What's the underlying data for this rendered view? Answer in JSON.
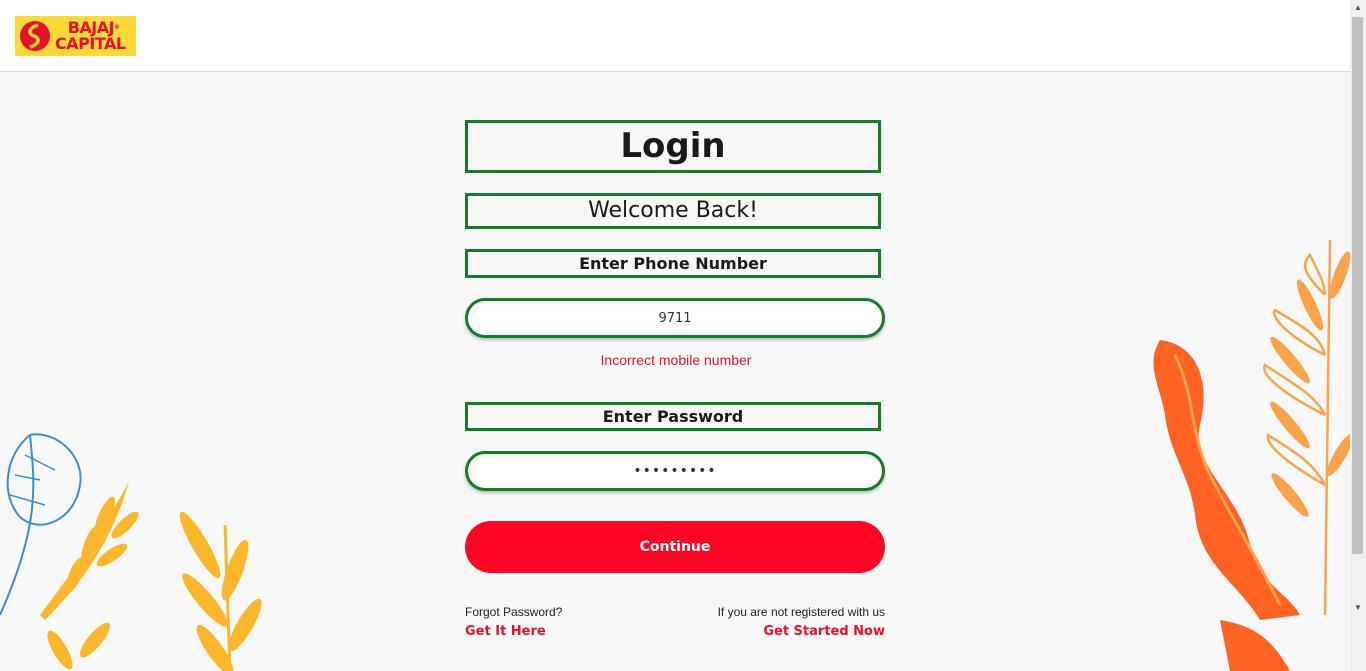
{
  "header": {
    "logo": {
      "line1": "BAJAJ",
      "line2": "CAPITAL",
      "trademark": "®",
      "brand_color": "#e8112d",
      "background": "#fcd93a"
    }
  },
  "login": {
    "title": "Login",
    "subtitle": "Welcome Back!",
    "phone_label": "Enter Phone Number",
    "phone_value": "9711",
    "error": "Incorrect mobile number",
    "password_label": "Enter Password",
    "password_value": "•••••••••",
    "continue_label": "Continue",
    "forgot_text": "Forgot Password?",
    "forgot_link": "Get It Here",
    "register_text": "If you are not registered with us",
    "register_link": "Get Started Now"
  },
  "colors": {
    "accent": "#ff0525",
    "outline": "#127d27",
    "background": "#f8f8f8"
  },
  "icons": [
    "logo-mark-icon",
    "leaf-decoration-icon",
    "scroll-up-icon",
    "scroll-down-icon"
  ]
}
